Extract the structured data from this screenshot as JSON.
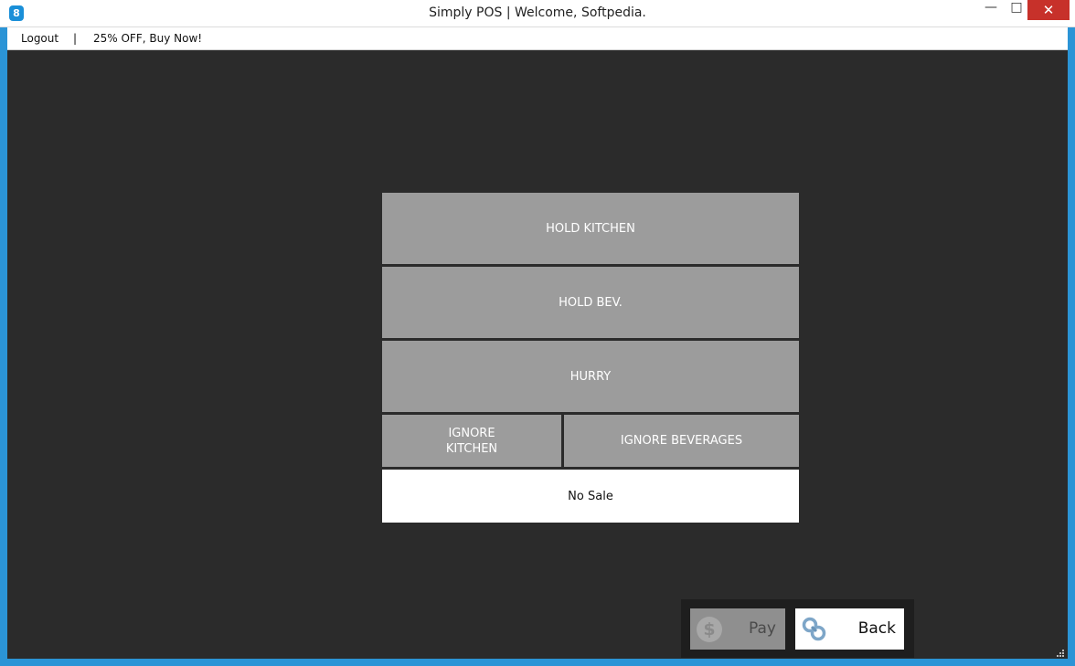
{
  "window": {
    "title": "Simply POS | Welcome, Softpedia.",
    "icon": "simplypos-app-icon",
    "controls": {
      "minimize": "—",
      "maximize": "□",
      "close": "✕"
    }
  },
  "menu": {
    "logout": "Logout",
    "separator": "|",
    "promo": "25% OFF, Buy Now!"
  },
  "options": {
    "hold_kitchen": "HOLD KITCHEN",
    "hold_bev": "HOLD BEV.",
    "hurry": "HURRY",
    "ignore_kitchen_line1": "IGNORE",
    "ignore_kitchen_line2": "KITCHEN",
    "ignore_beverages": "IGNORE BEVERAGES",
    "no_sale": "No Sale"
  },
  "actions": {
    "pay_label": "Pay",
    "pay_icon": "dollar-coin-icon",
    "pay_icon_glyph": "$",
    "back_label": "Back",
    "back_icon": "link-chain-icon"
  },
  "colors": {
    "content_bg": "#2b2b2b",
    "option_button": "#9c9c9c",
    "close_button": "#c7312a",
    "window_border": "#2b94d6"
  }
}
